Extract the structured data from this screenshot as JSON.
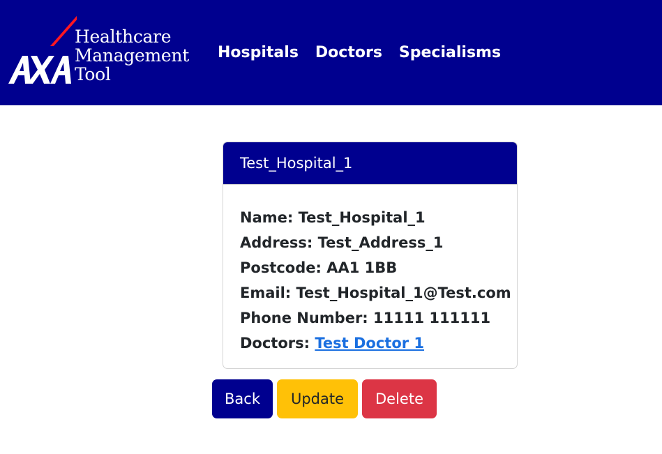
{
  "brand": {
    "logo_mark": "AXA",
    "line1": "Healthcare",
    "line2": "Management",
    "line3": "Tool"
  },
  "nav": {
    "items": [
      {
        "label": "Hospitals"
      },
      {
        "label": "Doctors"
      },
      {
        "label": "Specialisms"
      }
    ]
  },
  "card": {
    "title": "Test_Hospital_1",
    "fields": {
      "name_label": "Name:",
      "name_value": "Test_Hospital_1",
      "address_label": "Address:",
      "address_value": "Test_Address_1",
      "postcode_label": "Postcode:",
      "postcode_value": "AA1 1BB",
      "email_label": "Email:",
      "email_value": "Test_Hospital_1@Test.com",
      "phone_label": "Phone Number:",
      "phone_value": "11111 111111",
      "doctors_label": "Doctors:",
      "doctors_value": "Test Doctor 1"
    }
  },
  "actions": {
    "back_label": "Back",
    "update_label": "Update",
    "delete_label": "Delete"
  },
  "colors": {
    "brand_blue": "#00008f",
    "accent_red": "#ff1721",
    "update_yellow": "#ffc107",
    "delete_red": "#dc3545",
    "link_blue": "#1a6fe0"
  }
}
